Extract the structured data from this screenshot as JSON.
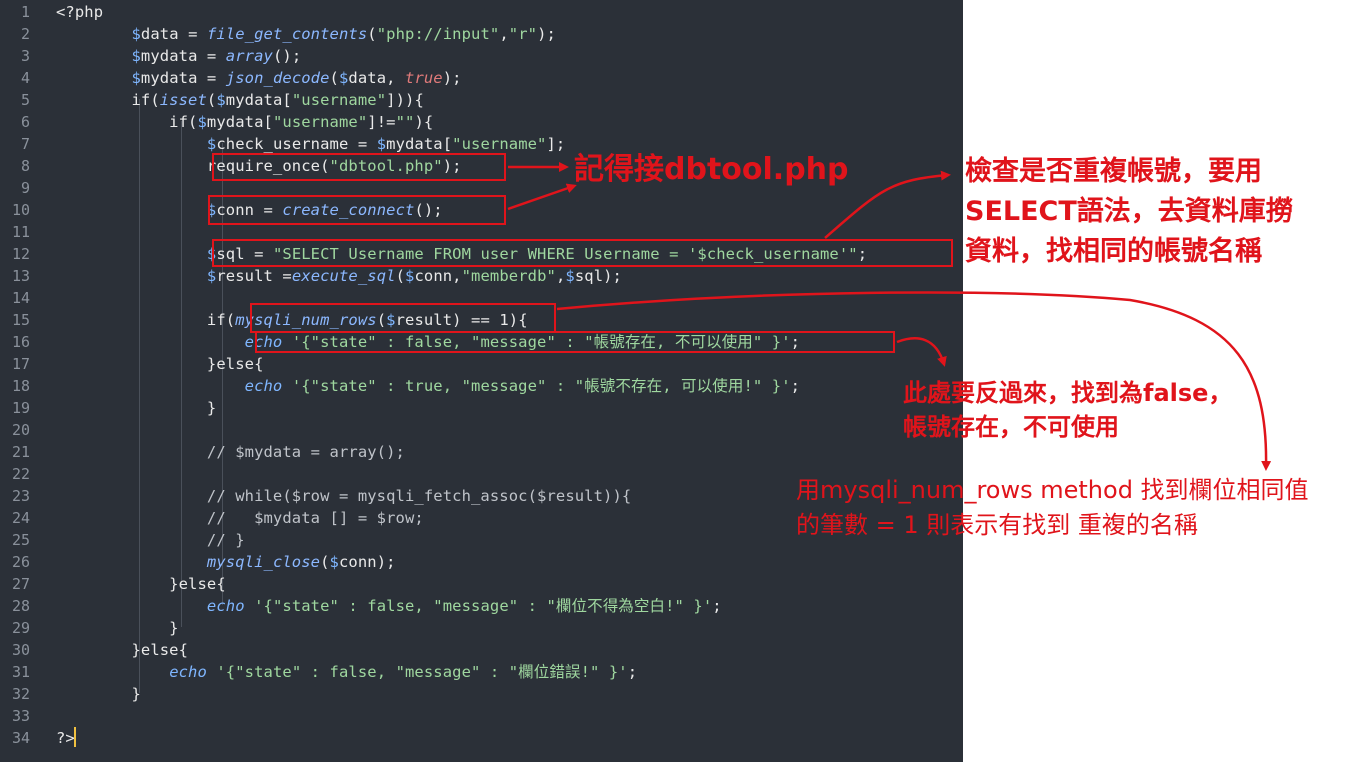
{
  "lines": [
    {
      "n": "1",
      "code": "<?php"
    },
    {
      "n": "2",
      "code": "        $data = file_get_contents(\"php://input\",\"r\");"
    },
    {
      "n": "3",
      "code": "        $mydata = array();"
    },
    {
      "n": "4",
      "code": "        $mydata = json_decode($data, true);"
    },
    {
      "n": "5",
      "code": "        if(isset($mydata[\"username\"])){"
    },
    {
      "n": "6",
      "code": "            if($mydata[\"username\"]!=\"\"){"
    },
    {
      "n": "7",
      "code": "                $check_username = $mydata[\"username\"];"
    },
    {
      "n": "8",
      "code": "                require_once(\"dbtool.php\");"
    },
    {
      "n": "9",
      "code": ""
    },
    {
      "n": "10",
      "code": "                $conn = create_connect();"
    },
    {
      "n": "11",
      "code": ""
    },
    {
      "n": "12",
      "code": "                $sql = \"SELECT Username FROM user WHERE Username = '$check_username'\";"
    },
    {
      "n": "13",
      "code": "                $result =execute_sql($conn,\"memberdb\",$sql);"
    },
    {
      "n": "14",
      "code": ""
    },
    {
      "n": "15",
      "code": "                if(mysqli_num_rows($result) == 1){"
    },
    {
      "n": "16",
      "code": "                    echo '{\"state\" : false, \"message\" : \"帳號存在, 不可以使用\" }';"
    },
    {
      "n": "17",
      "code": "                }else{"
    },
    {
      "n": "18",
      "code": "                    echo '{\"state\" : true, \"message\" : \"帳號不存在, 可以使用!\" }';"
    },
    {
      "n": "19",
      "code": "                }"
    },
    {
      "n": "20",
      "code": ""
    },
    {
      "n": "21",
      "code": "                // $mydata = array();"
    },
    {
      "n": "22",
      "code": ""
    },
    {
      "n": "23",
      "code": "                // while($row = mysqli_fetch_assoc($result)){"
    },
    {
      "n": "24",
      "code": "                //   $mydata [] = $row;"
    },
    {
      "n": "25",
      "code": "                // }"
    },
    {
      "n": "26",
      "code": "                mysqli_close($conn);"
    },
    {
      "n": "27",
      "code": "            }else{"
    },
    {
      "n": "28",
      "code": "                echo '{\"state\" : false, \"message\" : \"欄位不得為空白!\" }';"
    },
    {
      "n": "29",
      "code": "            }"
    },
    {
      "n": "30",
      "code": "        }else{"
    },
    {
      "n": "31",
      "code": "            echo '{\"state\" : false, \"message\" : \"欄位錯誤!\" }';"
    },
    {
      "n": "32",
      "code": "        }"
    },
    {
      "n": "33",
      "code": ""
    },
    {
      "n": "34",
      "code": "?>"
    }
  ],
  "annotations": {
    "a1": "記得接dbtool.php",
    "a2_line1": "檢查是否重複帳號，要用",
    "a2_line2": "SELECT語法，去資料庫撈",
    "a2_line3": "資料，找相同的帳號名稱",
    "a3_line1": "此處要反過來，找到為false，",
    "a3_line2": "帳號存在，不可使用",
    "a4_line1": "用mysqli_num_rows method 找到欄位相同值",
    "a4_line2": "的筆數 = 1 則表示有找到 重複的名稱"
  },
  "colors": {
    "editor_bg": "#2b3038",
    "annotation_red": "#e0141b",
    "string_green": "#9fd79f",
    "variable_blue": "#7fb6ff"
  }
}
